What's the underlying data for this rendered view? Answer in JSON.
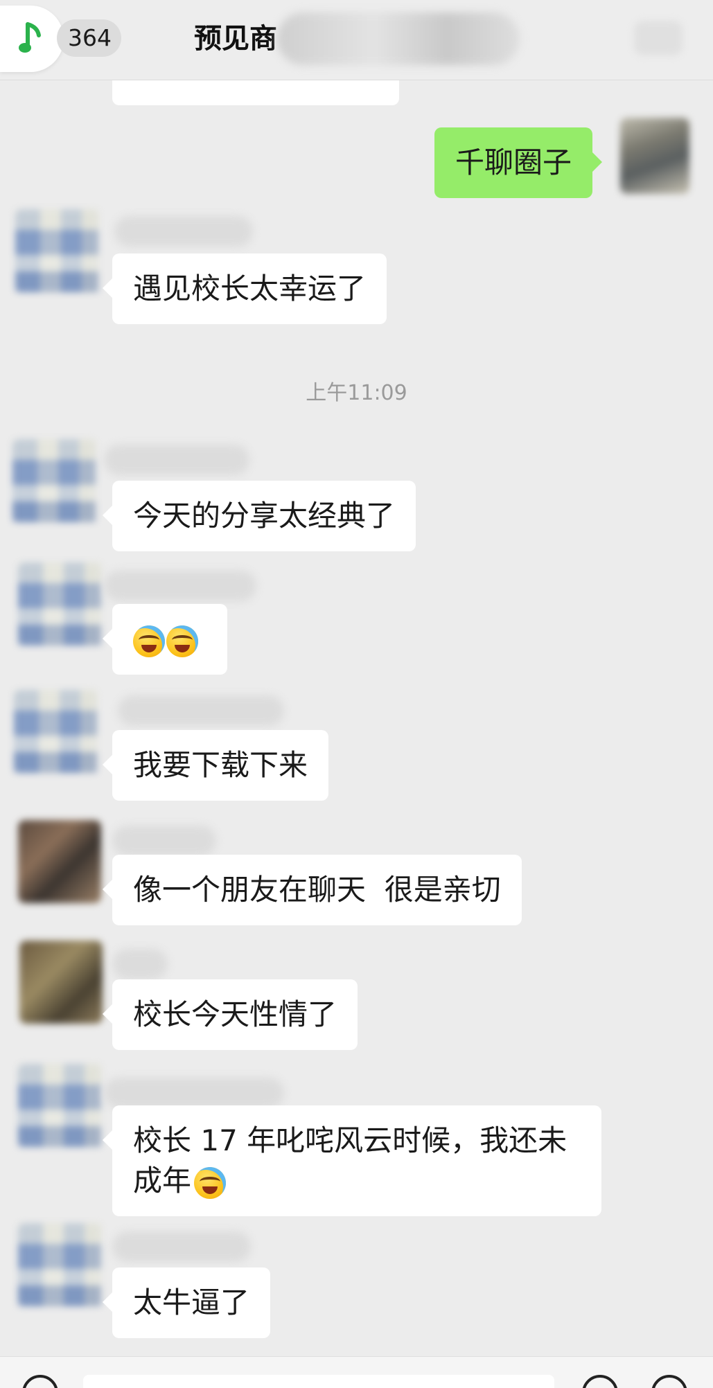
{
  "header": {
    "unread_count": "364",
    "title_visible": "预见商",
    "music_icon": "music-note-icon"
  },
  "timestamp": "上午11:09",
  "messages": {
    "top_partial": "",
    "self_msg": "千聊圈子",
    "m1": "遇见校长太幸运了",
    "m2": "今天的分享太经典了",
    "m4": "我要下载下来",
    "m5": "像一个朋友在聊天  很是亲切",
    "m6": "校长今天性情了",
    "m7_text": "校长 17 年叱咤风云时候，我还未成年",
    "m8": "太牛逼了"
  },
  "colors": {
    "background": "#ececec",
    "self_bubble": "#95ec69",
    "other_bubble": "#ffffff",
    "music_green": "#2bb24c"
  }
}
